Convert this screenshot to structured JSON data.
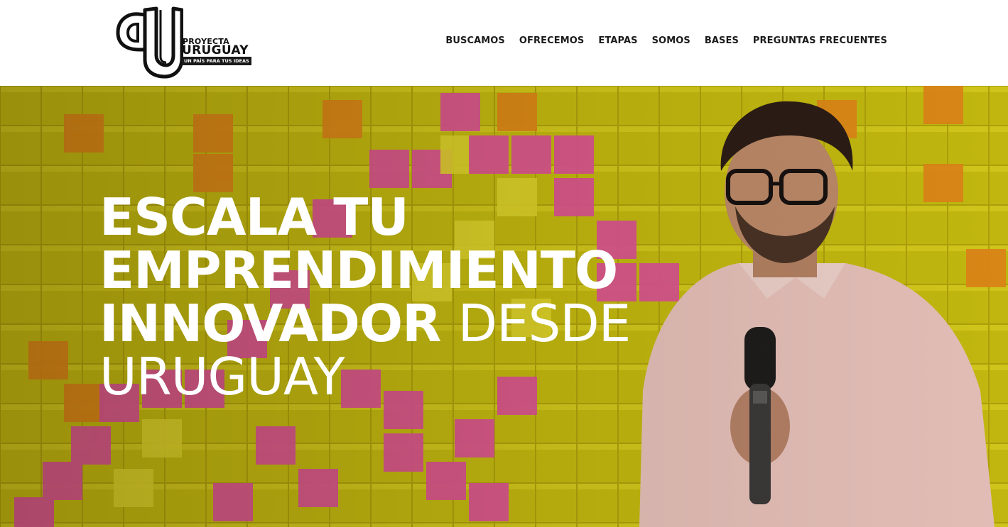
{
  "brand": {
    "line1": "PROYECTA",
    "line2": "URUGUAY",
    "tagline": "UN PAÍS PARA TUS IDEAS"
  },
  "nav": {
    "items": [
      {
        "label": "BUSCAMOS"
      },
      {
        "label": "OFRECEMOS"
      },
      {
        "label": "ETAPAS"
      },
      {
        "label": "SOMOS"
      },
      {
        "label": "BASES"
      },
      {
        "label": "PREGUNTAS FRECUENTES"
      }
    ]
  },
  "hero": {
    "line1": "ESCALA TU",
    "line2": "EMPRENDIMIENTO",
    "line3_bold": "INNOVADOR",
    "line3_light": "DESDE",
    "line4": "URUGUAY"
  },
  "colors": {
    "accent_yellow": "#d9cf1a",
    "accent_pink": "#e8559a",
    "accent_orange": "#e8931d",
    "text_dark": "#1b1b1b"
  }
}
